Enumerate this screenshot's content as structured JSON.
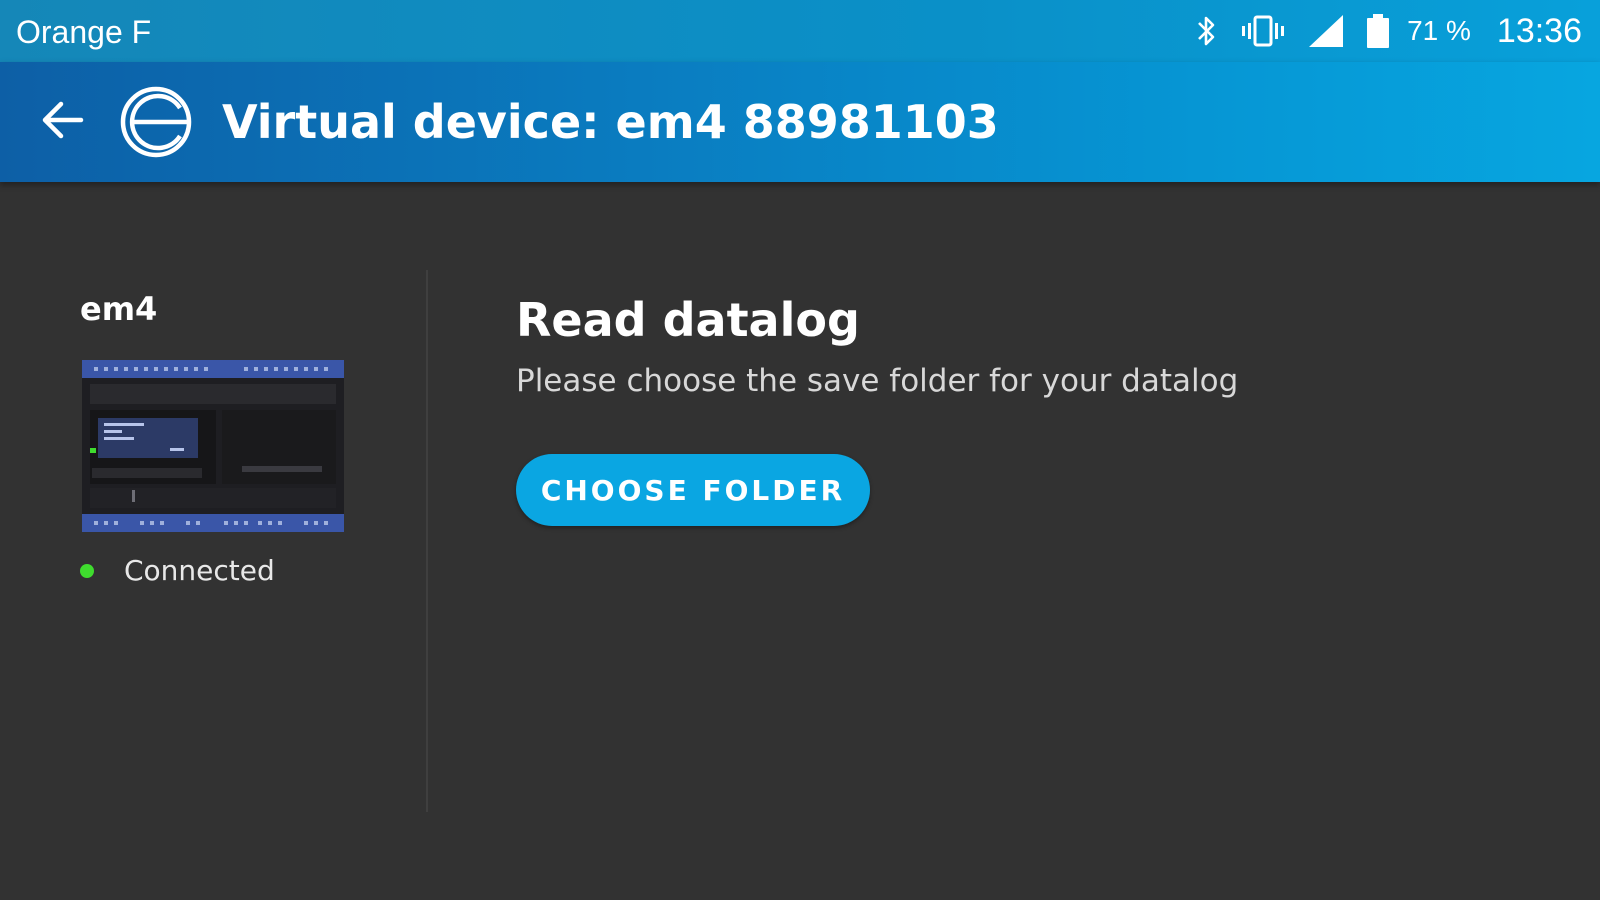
{
  "status_bar": {
    "carrier": "Orange F",
    "battery_percent": "71 %",
    "time": "13:36",
    "icons": [
      "bluetooth-icon",
      "vibrate-icon",
      "signal-icon",
      "battery-icon"
    ]
  },
  "app_bar": {
    "title": "Virtual device: em4 88981103",
    "back_icon": "arrow-left-icon",
    "logo_icon": "app-logo-icon"
  },
  "device": {
    "name": "em4",
    "status": "Connected",
    "status_color": "#3fdc2e"
  },
  "datalog": {
    "title": "Read datalog",
    "description": "Please choose the save folder for your datalog",
    "button_label": "CHOOSE FOLDER"
  },
  "colors": {
    "accent": "#0aa6e2",
    "background": "#323232",
    "app_bar": "#0a7cc0"
  }
}
